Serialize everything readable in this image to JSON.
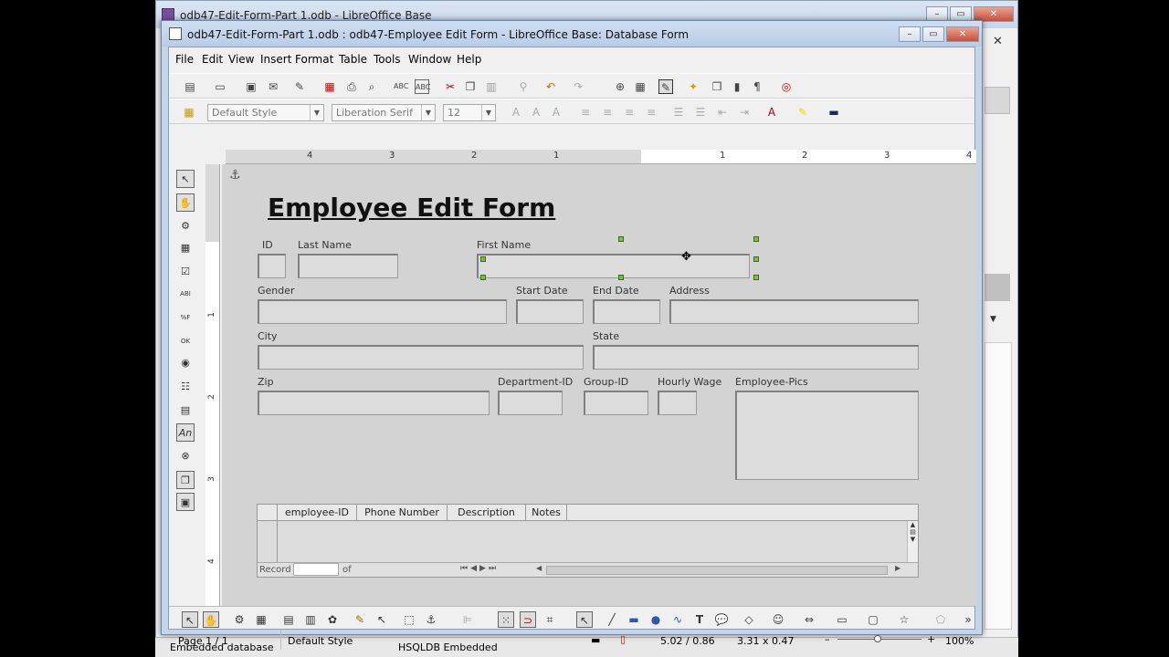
{
  "back_window": {
    "title": "odb47-Edit-Form-Part 1.odb - LibreOffice Base",
    "close_glyph": "✕",
    "status_left": "Embedded database",
    "status_right": "HSQLDB Embedded"
  },
  "window": {
    "title": "odb47-Edit-Form-Part 1.odb : odb47-Employee Edit Form  - LibreOffice Base: Database Form",
    "min": "–",
    "max": "▭",
    "close": "✕"
  },
  "menu": [
    "File",
    "Edit",
    "View",
    "Insert",
    "Format",
    "Table",
    "Tools",
    "Window",
    "Help"
  ],
  "format_bar": {
    "style": "Default Style",
    "font": "Liberation Serif",
    "size": "12"
  },
  "ruler": {
    "labels": [
      "4",
      "3",
      "2",
      "1",
      "1",
      "2",
      "3",
      "4"
    ]
  },
  "vruler": {
    "labels": [
      "1",
      "2",
      "3",
      "4"
    ]
  },
  "form": {
    "title": "Employee Edit Form",
    "labels": {
      "id": "ID",
      "last_name": "Last Name",
      "first_name": "First Name",
      "gender": "Gender",
      "start_date": "Start Date",
      "end_date": "End Date",
      "address": "Address",
      "city": "City",
      "state": "State",
      "zip": "Zip",
      "department_id": "Department-ID",
      "group_id": "Group-ID",
      "hourly_wage": "Hourly Wage",
      "employee_pics": "Employee-Pics"
    },
    "grid": {
      "columns": [
        "employee-ID",
        "Phone Number",
        "Description",
        "Notes"
      ],
      "record_label": "Record",
      "of_label": "of"
    }
  },
  "statusbar": {
    "page": "Page 1 / 1",
    "style": "Default Style",
    "position": "5.02 / 0.86",
    "size": "3.31 x 0.47",
    "zoom": "100%"
  },
  "icons": {
    "sidebar_an": "An"
  }
}
